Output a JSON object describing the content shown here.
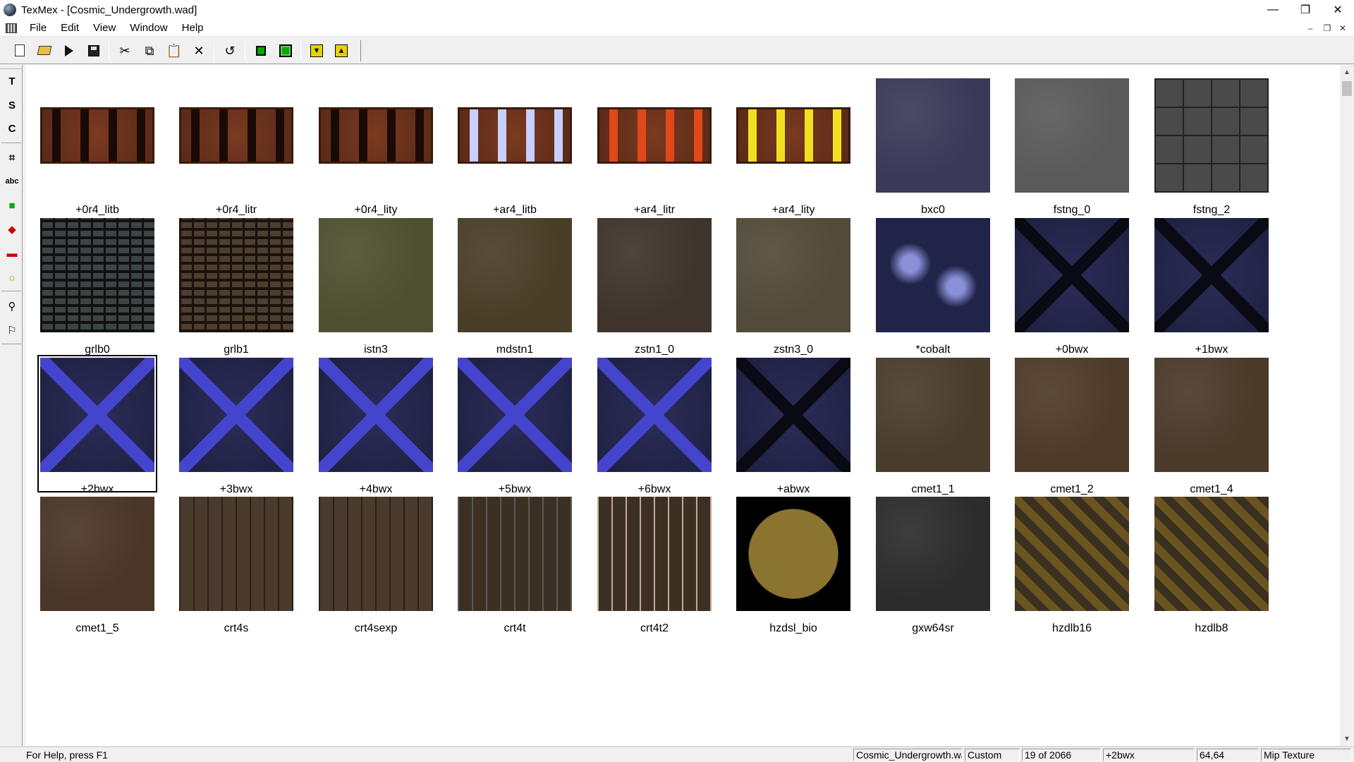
{
  "window": {
    "title": "TexMex - [Cosmic_Undergrowth.wad]",
    "controls": {
      "minimize": "—",
      "maximize": "❐",
      "close": "✕"
    }
  },
  "menu": [
    "File",
    "Edit",
    "View",
    "Window",
    "Help"
  ],
  "mdi_controls": {
    "minimize": "–",
    "restore": "❐",
    "close": "✕"
  },
  "toolbar": [
    {
      "icon": "new-document-icon"
    },
    {
      "icon": "open-folder-icon"
    },
    {
      "icon": "arrow-right-icon"
    },
    {
      "icon": "save-icon"
    },
    {
      "icon": "cut-icon"
    },
    {
      "icon": "copy-icon"
    },
    {
      "icon": "paste-icon"
    },
    {
      "icon": "delete-icon"
    },
    {
      "icon": "undo-icon"
    },
    {
      "icon": "green-square-icon"
    },
    {
      "icon": "fit-icon"
    },
    {
      "icon": "import-icon"
    },
    {
      "icon": "export-icon"
    }
  ],
  "palette": [
    {
      "icon": "text-tool-icon",
      "glyph": "T"
    },
    {
      "icon": "s-tool-icon",
      "glyph": "S"
    },
    {
      "icon": "rotate-tool-icon",
      "glyph": "C"
    },
    {
      "icon": "crop-tool-icon",
      "glyph": "⌗"
    },
    {
      "icon": "abc-tool-icon",
      "glyph": "abc"
    },
    {
      "icon": "green-tool-icon",
      "glyph": "■"
    },
    {
      "icon": "red-tool-icon",
      "glyph": "◆"
    },
    {
      "icon": "red-green-tool-icon",
      "glyph": "▬"
    },
    {
      "icon": "brightness-tool-icon",
      "glyph": "☼"
    },
    {
      "icon": "zoom-tool-icon",
      "glyph": "⚲"
    },
    {
      "icon": "run-tool-icon",
      "glyph": "⚐"
    }
  ],
  "textures": [
    {
      "name": "+0r4_litb",
      "kind": "strip",
      "color": "#5a2a18",
      "accent": "#1a0a06"
    },
    {
      "name": "+0r4_litr",
      "kind": "strip",
      "color": "#5a2a18",
      "accent": "#1a0a06"
    },
    {
      "name": "+0r4_lity",
      "kind": "strip",
      "color": "#5a2a18",
      "accent": "#1a0a06"
    },
    {
      "name": "+ar4_litb",
      "kind": "strip",
      "color": "#5a2a18",
      "accent": "#c8d0ff"
    },
    {
      "name": "+ar4_litr",
      "kind": "strip",
      "color": "#5a2a18",
      "accent": "#e04818"
    },
    {
      "name": "+ar4_lity",
      "kind": "strip",
      "color": "#5a2a18",
      "accent": "#f0e020"
    },
    {
      "name": "bxc0",
      "kind": "square",
      "color": "#3a3a58",
      "accent": "#8888aa"
    },
    {
      "name": "fstng_0",
      "kind": "square",
      "color": "#5a5a5a",
      "accent": "#444444"
    },
    {
      "name": "fstng_2",
      "kind": "square",
      "color": "#4a4a4a",
      "accent": "#222222"
    },
    {
      "name": "grlb0",
      "kind": "square",
      "color": "#3c4446",
      "accent": "#111111"
    },
    {
      "name": "grlb1",
      "kind": "square",
      "color": "#4e3e30",
      "accent": "#1a120c"
    },
    {
      "name": "istn3",
      "kind": "square",
      "color": "#4e5030",
      "accent": "#2a2a18"
    },
    {
      "name": "mdstn1",
      "kind": "square",
      "color": "#4a3e28",
      "accent": "#2a2418"
    },
    {
      "name": "zstn1_0",
      "kind": "square",
      "color": "#3e342c",
      "accent": "#2a221c"
    },
    {
      "name": "zstn3_0",
      "kind": "square",
      "color": "#524a3a",
      "accent": "#3a342a"
    },
    {
      "name": "*cobalt",
      "kind": "square",
      "color": "#202448",
      "accent": "#8a90d8"
    },
    {
      "name": "+0bwx",
      "kind": "square",
      "color": "#1e2040",
      "accent": "#0a0a14"
    },
    {
      "name": "+1bwx",
      "kind": "square",
      "color": "#1e2040",
      "accent": "#0a0a14"
    },
    {
      "name": "+2bwx",
      "kind": "square",
      "color": "#1e2040",
      "accent": "#4444cc"
    },
    {
      "name": "+3bwx",
      "kind": "square",
      "color": "#1e2040",
      "accent": "#4444cc"
    },
    {
      "name": "+4bwx",
      "kind": "square",
      "color": "#1e2040",
      "accent": "#4444cc"
    },
    {
      "name": "+5bwx",
      "kind": "square",
      "color": "#1e2040",
      "accent": "#4444cc"
    },
    {
      "name": "+6bwx",
      "kind": "square",
      "color": "#1e2040",
      "accent": "#4444cc"
    },
    {
      "name": "+abwx",
      "kind": "square",
      "color": "#1e2040",
      "accent": "#0a0a14"
    },
    {
      "name": "cmet1_1",
      "kind": "square",
      "color": "#4a3c2c",
      "accent": "#2a2018"
    },
    {
      "name": "cmet1_2",
      "kind": "square",
      "color": "#4e3a28",
      "accent": "#2a1c12"
    },
    {
      "name": "cmet1_4",
      "kind": "square",
      "color": "#4a3a2a",
      "accent": "#2a1c12"
    },
    {
      "name": "cmet1_5",
      "kind": "square",
      "color": "#4a3628",
      "accent": "#1a120c"
    },
    {
      "name": "crt4s",
      "kind": "square",
      "color": "#4a3a2c",
      "accent": "#2a2018"
    },
    {
      "name": "crt4sexp",
      "kind": "square",
      "color": "#4a3a2c",
      "accent": "#2a2018"
    },
    {
      "name": "crt4t",
      "kind": "square",
      "color": "#3c3024",
      "accent": "#5a5a5a"
    },
    {
      "name": "crt4t2",
      "kind": "square",
      "color": "#3c3024",
      "accent": "#c8a890"
    },
    {
      "name": "hzdsl_bio",
      "kind": "square",
      "color": "#8a7430",
      "accent": "#000000"
    },
    {
      "name": "gxw64sr",
      "kind": "square",
      "color": "#2c2c2c",
      "accent": "#1a1a1a"
    },
    {
      "name": "hzdlb16",
      "kind": "square",
      "color": "#3a3020",
      "accent": "#6a5420"
    },
    {
      "name": "hzdlb8",
      "kind": "square",
      "color": "#3a3020",
      "accent": "#6a5420"
    }
  ],
  "selected_texture": "+2bwx",
  "status": {
    "help": "For Help, press F1",
    "file": "Cosmic_Undergrowth.wad",
    "palette": "Custom",
    "index": "19 of 2066",
    "current": "+2bwx",
    "size": "64,64",
    "type": "Mip Texture"
  },
  "scrollbar": {
    "up": "▲",
    "down": "▼"
  }
}
